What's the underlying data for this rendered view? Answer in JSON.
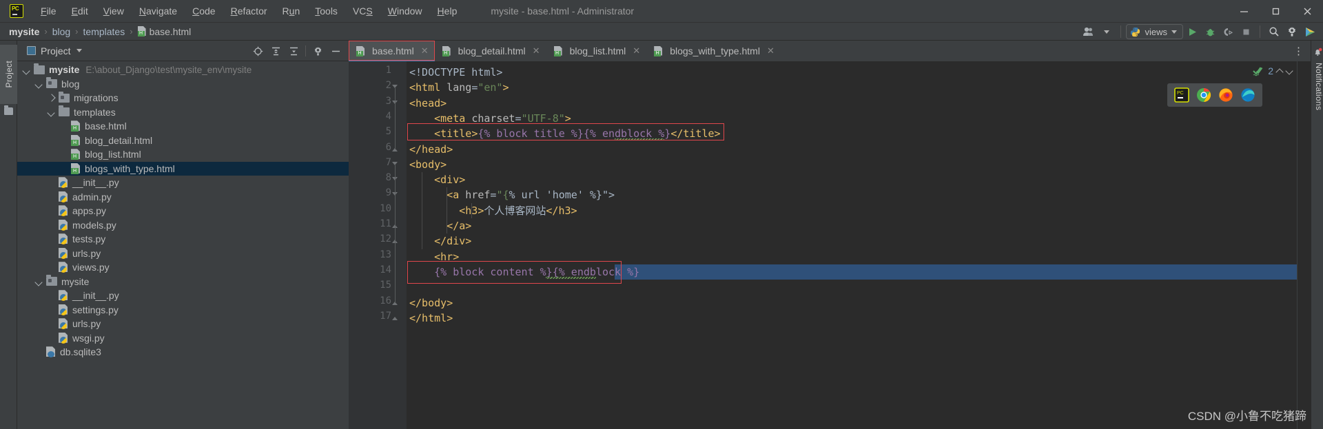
{
  "window": {
    "title": "mysite - base.html - Administrator",
    "logo_icon": "pycharm-logo-icon",
    "minimize_icon": "minimize-icon",
    "maximize_icon": "maximize-icon",
    "close_icon": "close-icon"
  },
  "menu": {
    "items": [
      {
        "label": "File",
        "mnemonic": "F"
      },
      {
        "label": "Edit",
        "mnemonic": "E"
      },
      {
        "label": "View",
        "mnemonic": "V"
      },
      {
        "label": "Navigate",
        "mnemonic": "N"
      },
      {
        "label": "Code",
        "mnemonic": "C"
      },
      {
        "label": "Refactor",
        "mnemonic": "R"
      },
      {
        "label": "Run",
        "mnemonic": "u"
      },
      {
        "label": "Tools",
        "mnemonic": "T"
      },
      {
        "label": "VCS",
        "mnemonic": "S"
      },
      {
        "label": "Window",
        "mnemonic": "W"
      },
      {
        "label": "Help",
        "mnemonic": "H"
      }
    ]
  },
  "breadcrumb": {
    "items": [
      "mysite",
      "blog",
      "templates",
      "base.html"
    ],
    "separator": "›",
    "file_icon": "html-file-icon"
  },
  "toolbar": {
    "user_icon": "user-account-icon",
    "run_config": {
      "icon": "python-icon",
      "label": "views",
      "dropdown_icon": "chevron-down-icon"
    },
    "run_icon": "run-icon",
    "debug_icon": "debug-icon",
    "coverage_icon": "run-with-coverage-icon",
    "stop_icon": "stop-icon",
    "search_icon": "search-icon",
    "settings_icon": "gear-icon",
    "updates_icon": "ide-updates-icon"
  },
  "left_strip": {
    "project_tab": "Project",
    "folder_icon": "folder-icon"
  },
  "project_panel": {
    "title": "Project",
    "title_dropdown_icon": "chevron-down-icon",
    "icons": [
      "select-opened-file-icon",
      "expand-all-icon",
      "collapse-all-icon",
      "gear-icon",
      "hide-icon"
    ],
    "tree": [
      {
        "label": "mysite",
        "path": "E:\\about_Django\\test\\mysite_env\\mysite",
        "depth": 0,
        "icon": "folder-icon",
        "arrow": "down",
        "bold": true,
        "selected": false
      },
      {
        "label": "blog",
        "path": "",
        "depth": 1,
        "icon": "folder-module-icon",
        "arrow": "down",
        "bold": false,
        "selected": false
      },
      {
        "label": "migrations",
        "path": "",
        "depth": 2,
        "icon": "folder-module-icon",
        "arrow": "right",
        "bold": false,
        "selected": false
      },
      {
        "label": "templates",
        "path": "",
        "depth": 2,
        "icon": "folder-icon",
        "arrow": "down",
        "bold": false,
        "selected": false
      },
      {
        "label": "base.html",
        "path": "",
        "depth": 3,
        "icon": "html-file-icon",
        "arrow": "none",
        "bold": false,
        "selected": false
      },
      {
        "label": "blog_detail.html",
        "path": "",
        "depth": 3,
        "icon": "html-file-icon",
        "arrow": "none",
        "bold": false,
        "selected": false
      },
      {
        "label": "blog_list.html",
        "path": "",
        "depth": 3,
        "icon": "html-file-icon",
        "arrow": "none",
        "bold": false,
        "selected": false
      },
      {
        "label": "blogs_with_type.html",
        "path": "",
        "depth": 3,
        "icon": "html-file-icon",
        "arrow": "none",
        "bold": false,
        "selected": true
      },
      {
        "label": "__init__.py",
        "path": "",
        "depth": 2,
        "icon": "python-file-icon",
        "arrow": "none",
        "bold": false,
        "selected": false
      },
      {
        "label": "admin.py",
        "path": "",
        "depth": 2,
        "icon": "python-file-icon",
        "arrow": "none",
        "bold": false,
        "selected": false
      },
      {
        "label": "apps.py",
        "path": "",
        "depth": 2,
        "icon": "python-file-icon",
        "arrow": "none",
        "bold": false,
        "selected": false
      },
      {
        "label": "models.py",
        "path": "",
        "depth": 2,
        "icon": "python-file-icon",
        "arrow": "none",
        "bold": false,
        "selected": false
      },
      {
        "label": "tests.py",
        "path": "",
        "depth": 2,
        "icon": "python-file-icon",
        "arrow": "none",
        "bold": false,
        "selected": false
      },
      {
        "label": "urls.py",
        "path": "",
        "depth": 2,
        "icon": "python-file-icon",
        "arrow": "none",
        "bold": false,
        "selected": false
      },
      {
        "label": "views.py",
        "path": "",
        "depth": 2,
        "icon": "python-file-icon",
        "arrow": "none",
        "bold": false,
        "selected": false
      },
      {
        "label": "mysite",
        "path": "",
        "depth": 1,
        "icon": "folder-module-icon",
        "arrow": "down",
        "bold": false,
        "selected": false
      },
      {
        "label": "__init__.py",
        "path": "",
        "depth": 2,
        "icon": "python-file-icon",
        "arrow": "none",
        "bold": false,
        "selected": false
      },
      {
        "label": "settings.py",
        "path": "",
        "depth": 2,
        "icon": "python-file-icon",
        "arrow": "none",
        "bold": false,
        "selected": false
      },
      {
        "label": "urls.py",
        "path": "",
        "depth": 2,
        "icon": "python-file-icon",
        "arrow": "none",
        "bold": false,
        "selected": false
      },
      {
        "label": "wsgi.py",
        "path": "",
        "depth": 2,
        "icon": "python-file-icon",
        "arrow": "none",
        "bold": false,
        "selected": false
      },
      {
        "label": "db.sqlite3",
        "path": "",
        "depth": 1,
        "icon": "db-file-icon",
        "arrow": "none",
        "bold": false,
        "selected": false
      }
    ]
  },
  "editor": {
    "tabs": [
      {
        "label": "base.html",
        "icon": "html-file-icon",
        "active": true,
        "close_icon": "close-icon"
      },
      {
        "label": "blog_detail.html",
        "icon": "html-file-icon",
        "active": false,
        "close_icon": "close-icon"
      },
      {
        "label": "blog_list.html",
        "icon": "html-file-icon",
        "active": false,
        "close_icon": "close-icon"
      },
      {
        "label": "blogs_with_type.html",
        "icon": "html-file-icon",
        "active": false,
        "close_icon": "close-icon"
      }
    ],
    "tab_overflow_icon": "more-options-icon",
    "inspection": {
      "status_icon": "inspection-ok-icon",
      "count": "2",
      "prev_icon": "chevron-up-icon",
      "next_icon": "chevron-down-icon"
    },
    "browser_popup": {
      "icons": [
        "pycharm-browser-icon",
        "chrome-icon",
        "firefox-icon",
        "edge-icon"
      ]
    },
    "lines": [
      {
        "num": "1",
        "text": "<!DOCTYPE html>"
      },
      {
        "num": "2",
        "text": "<html lang=\"en\">"
      },
      {
        "num": "3",
        "text": "<head>"
      },
      {
        "num": "4",
        "text": "    <meta charset=\"UTF-8\">"
      },
      {
        "num": "5",
        "text": "    <title>{% block title %}{% endblock %}</title>"
      },
      {
        "num": "6",
        "text": "</head>"
      },
      {
        "num": "7",
        "text": "<body>"
      },
      {
        "num": "8",
        "text": "    <div>"
      },
      {
        "num": "9",
        "text": "      <a href=\"{% url 'home' %}\">"
      },
      {
        "num": "10",
        "text": "        <h3>个人博客网站</h3>"
      },
      {
        "num": "11",
        "text": "      </a>"
      },
      {
        "num": "12",
        "text": "    </div>"
      },
      {
        "num": "13",
        "text": "    <hr>"
      },
      {
        "num": "14",
        "text": "    {% block content %}{% endblock %}"
      },
      {
        "num": "15",
        "text": ""
      },
      {
        "num": "16",
        "text": "</body>"
      },
      {
        "num": "17",
        "text": "</html>"
      }
    ]
  },
  "right_strip": {
    "notifications_label": "Notifications",
    "bell_icon": "notifications-bell-icon"
  },
  "watermark": {
    "text": "CSDN @小鲁不吃猪蹄"
  },
  "colors": {
    "bg_chrome": "#3c3f41",
    "bg_editor": "#2b2b2b",
    "gutter": "#313335",
    "tag": "#e8bf6a",
    "string": "#6a8759",
    "django": "#9876aa",
    "text": "#a9b7c6",
    "selection": "#2f5079",
    "highlight_box": "#e0474c",
    "tree_selected": "#0d293e"
  }
}
